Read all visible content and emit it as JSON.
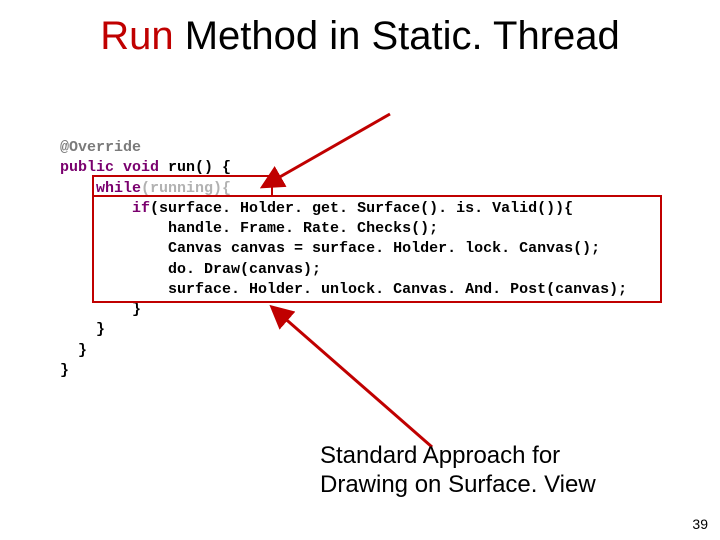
{
  "title": {
    "red": "Run",
    "rest": " Method in Static. Thread"
  },
  "code": {
    "l1_annot": "@Override",
    "l2_kw1": "public",
    "l2_kw2": "void",
    "l2_name": " run() {",
    "l3_kw": "while",
    "l3_rest": "(running){",
    "l4_kw": "if",
    "l4_args": "(surface. Holder. get. Surface(). is. Valid()){",
    "l5": "handle. Frame. Rate. Checks();",
    "l6": "Canvas canvas = surface. Holder. lock. Canvas();",
    "l7": "do. Draw(canvas);",
    "l8": "surface. Holder. unlock. Canvas. And. Post(canvas);",
    "l9": "}",
    "l10": "}",
    "l11": "}",
    "l12": "}"
  },
  "caption": {
    "line1": "Standard Approach for",
    "line2": "Drawing on Surface. View"
  },
  "pagenum": "39"
}
